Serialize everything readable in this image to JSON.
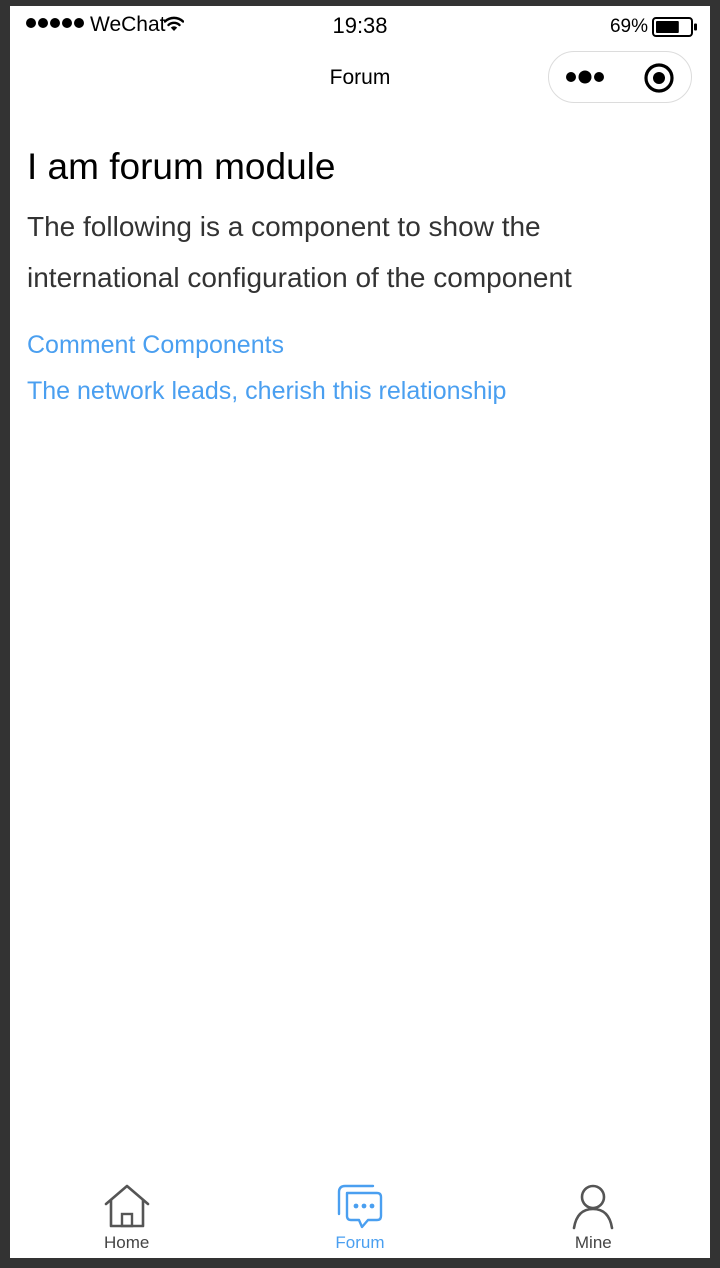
{
  "status_bar": {
    "carrier": "WeChat",
    "time": "19:38",
    "battery": "69%",
    "battery_level": 0.69
  },
  "nav": {
    "title": "Forum"
  },
  "main": {
    "heading": "I am forum module",
    "description": "The following is a component to show the international configuration of the component",
    "links": [
      "Comment Components",
      "The network leads, cherish this relationship"
    ]
  },
  "tab_bar": {
    "items": [
      {
        "label": "Home",
        "icon": "home-icon"
      },
      {
        "label": "Forum",
        "icon": "forum-icon",
        "active": true
      },
      {
        "label": "Mine",
        "icon": "user-icon"
      }
    ]
  },
  "colors": {
    "link": "#4a9ff0",
    "active_tab": "#4a9ff0",
    "background": "#ffffff"
  }
}
